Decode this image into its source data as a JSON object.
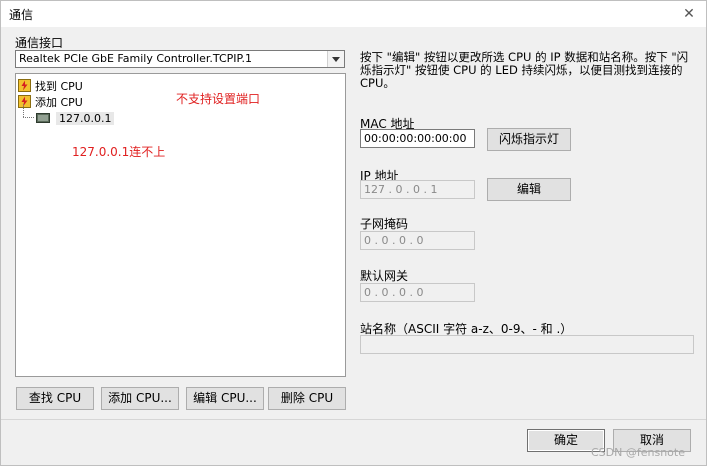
{
  "window": {
    "title": "通信",
    "close_glyph": "✕"
  },
  "left": {
    "interface_label": "通信接口",
    "interface_value": "Realtek PCIe GbE Family Controller.TCPIP.1",
    "tree": [
      {
        "label": "找到 CPU"
      },
      {
        "label": "添加 CPU"
      },
      {
        "label": "127.0.0.1"
      }
    ],
    "annotation_unsupported": "不支持设置端口",
    "annotation_noconnect": "127.0.0.1连不上",
    "buttons": {
      "find": "查找 CPU",
      "add": "添加 CPU...",
      "edit": "编辑 CPU...",
      "delete": "删除 CPU"
    }
  },
  "right": {
    "description": "按下 \"编辑\" 按钮以更改所选 CPU 的 IP 数据和站名称。按下 \"闪烁指示灯\" 按钮使 CPU 的 LED 持续闪烁，以便目测找到连接的 CPU。",
    "mac_label": "MAC 地址",
    "mac_value": "00:00:00:00:00:00",
    "blink_button": "闪烁指示灯",
    "ip_label": "IP 地址",
    "ip_value": "127 .  0  .  0  .  1",
    "edit_button": "编辑",
    "subnet_label": "子网掩码",
    "subnet_value": "  0  .  0  .  0  .  0",
    "gateway_label": "默认网关",
    "gateway_value": "  0  .  0  .  0  .  0",
    "station_label": "站名称（ASCII 字符 a-z、0-9、- 和 .）",
    "station_value": ""
  },
  "footer": {
    "ok": "确定",
    "cancel": "取消"
  },
  "watermark": "CSDN @fensnote",
  "colors": {
    "annotation": "#e02020",
    "dialog_bg": "#f0f0f0"
  }
}
